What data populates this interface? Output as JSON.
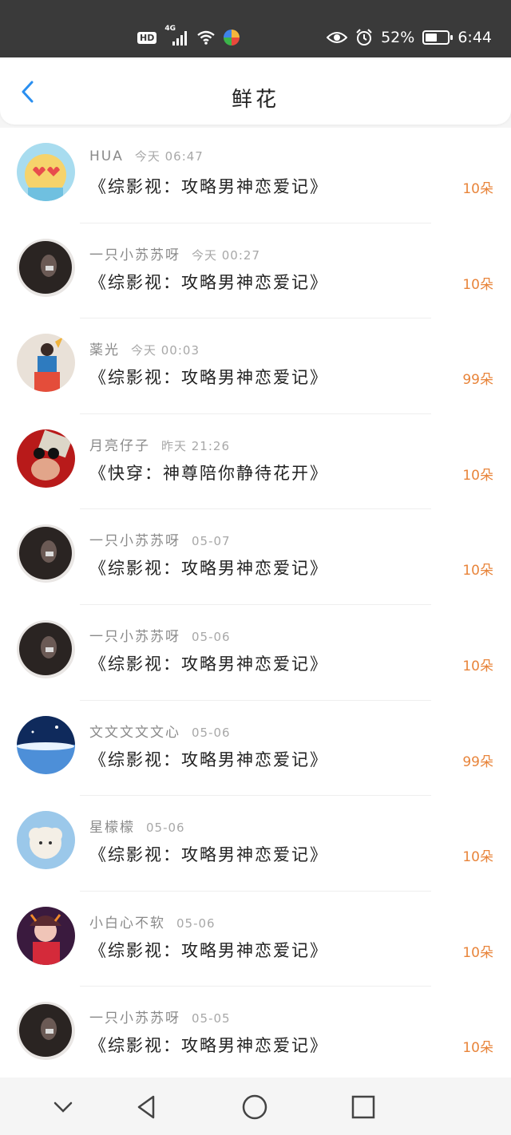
{
  "status": {
    "time": "6:44",
    "battery_pct": "52%",
    "battery_fill": 0.52,
    "icons": [
      "hd-icon",
      "4g-signal-icon",
      "wifi-icon",
      "app-icon",
      "eye-icon",
      "alarm-icon",
      "battery-icon"
    ]
  },
  "header": {
    "title": "鲜花",
    "back_icon": "chevron-left-icon",
    "accent": "#2a8ff0"
  },
  "items": [
    {
      "name": "HUA",
      "time": "今天 06:47",
      "book": "《综影视：攻略男神恋爱记》",
      "count": "10朵",
      "avatar": "cartoon"
    },
    {
      "name": "一只小苏苏呀",
      "time": "今天 00:27",
      "book": "《综影视：攻略男神恋爱记》",
      "count": "10朵",
      "avatar": "dark"
    },
    {
      "name": "薬光",
      "time": "今天 00:03",
      "book": "《综影视：攻略男神恋爱记》",
      "count": "99朵",
      "avatar": "colorful"
    },
    {
      "name": "月亮仔子",
      "time": "昨天 21:26",
      "book": "《快穿：神尊陪你静待花开》",
      "count": "10朵",
      "avatar": "red"
    },
    {
      "name": "一只小苏苏呀",
      "time": "05-07",
      "book": "《综影视：攻略男神恋爱记》",
      "count": "10朵",
      "avatar": "dark"
    },
    {
      "name": "一只小苏苏呀",
      "time": "05-06",
      "book": "《综影视：攻略男神恋爱记》",
      "count": "10朵",
      "avatar": "dark"
    },
    {
      "name": "文文文文文心",
      "time": "05-06",
      "book": "《综影视：攻略男神恋爱记》",
      "count": "99朵",
      "avatar": "sky"
    },
    {
      "name": "星檬檬",
      "time": "05-06",
      "book": "《综影视：攻略男神恋爱记》",
      "count": "10朵",
      "avatar": "sheep"
    },
    {
      "name": "小白心不软",
      "time": "05-06",
      "book": "《综影视：攻略男神恋爱记》",
      "count": "10朵",
      "avatar": "pink"
    },
    {
      "name": "一只小苏苏呀",
      "time": "05-05",
      "book": "《综影视：攻略男神恋爱记》",
      "count": "10朵",
      "avatar": "dark"
    }
  ],
  "colors": {
    "count": "#e8843a",
    "name": "#8a8a8a"
  },
  "navbar": [
    "collapse-chevron-icon",
    "back-triangle-icon",
    "home-circle-icon",
    "recents-square-icon"
  ]
}
